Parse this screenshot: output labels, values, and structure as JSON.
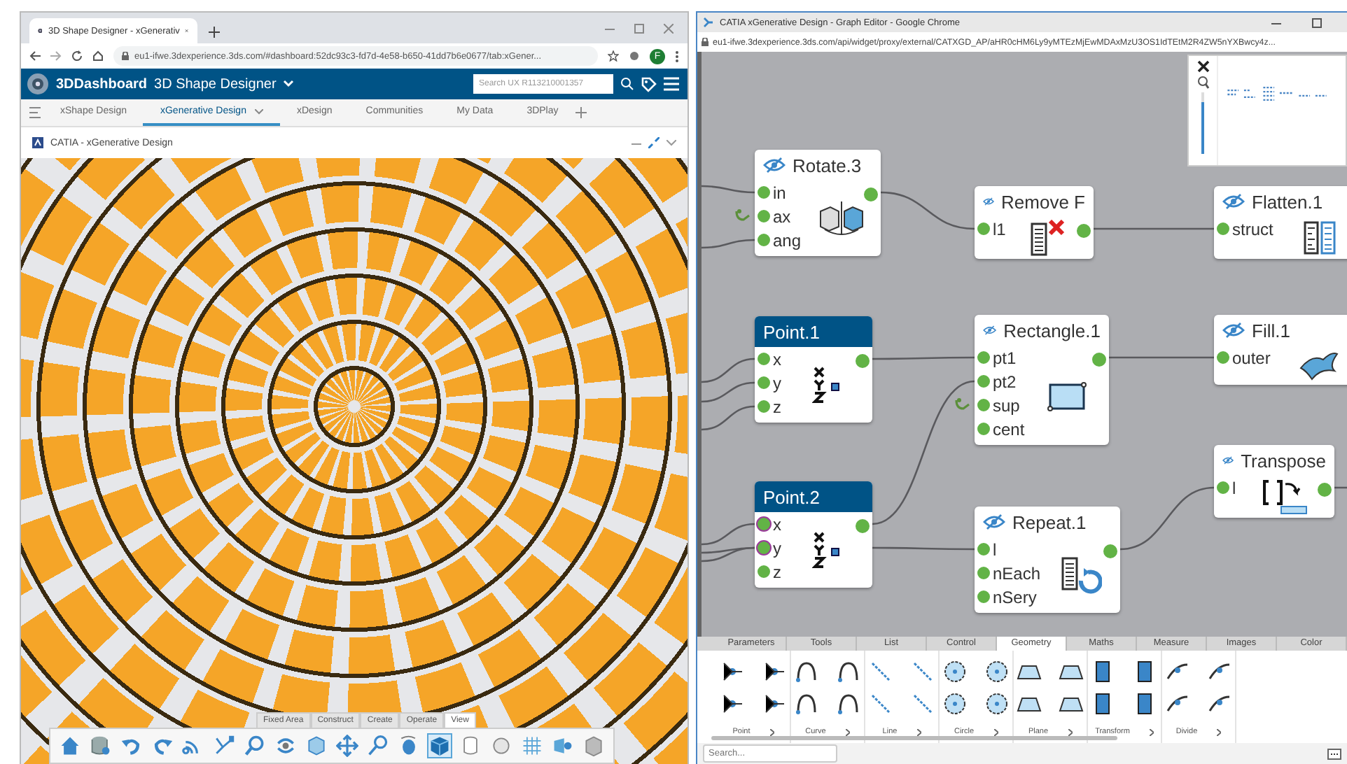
{
  "left_window": {
    "tab_title": "3D Shape Designer - xGenerativ",
    "url": "eu1-ifwe.3dexperience.3ds.com/#dashboard:52dc93c3-fd7d-4e58-b650-41dd7b6e0677/tab:xGener...",
    "avatar": "F",
    "app_bar": {
      "brand": "3DDashboard",
      "title": "3D Shape Designer",
      "search": {
        "placeholder": "Search UX R113210001357"
      }
    },
    "tabs": [
      {
        "label": "xShape Design",
        "selected": false
      },
      {
        "label": "xGenerative Design",
        "selected": true
      },
      {
        "label": "xDesign",
        "selected": false
      },
      {
        "label": "Communities",
        "selected": false
      },
      {
        "label": "My Data",
        "selected": false
      },
      {
        "label": "3DPlay",
        "selected": false
      }
    ],
    "widget": {
      "title": "CATIA - xGenerative Design"
    },
    "action_bar": {
      "tabs": [
        {
          "label": "Fixed Area",
          "selected": false
        },
        {
          "label": "Construct",
          "selected": false
        },
        {
          "label": "Create",
          "selected": false
        },
        {
          "label": "Operate",
          "selected": false
        },
        {
          "label": "View",
          "selected": true
        }
      ]
    }
  },
  "right_window": {
    "title": "CATIA xGenerative Design - Graph Editor - Google Chrome",
    "url": "eu1-ifwe.3dexperience.3ds.com/api/widget/proxy/external/CATXGD_AP/aHR0cHM6Ly9yMTEzMjEwMDAxMzU3OS1IdTEtM2R4ZW5nYXBwcy4z...",
    "zoom_slider": {
      "level": 0.85
    },
    "nodes": [
      {
        "title": "Rotate.3",
        "kind": "rotate",
        "selected": false,
        "visibility_off": true,
        "inputs": [
          {
            "label": "in",
            "kind": "data",
            "highlighted": false
          },
          {
            "label": "ax",
            "kind": "parameter",
            "highlighted": false
          },
          {
            "label": "ang",
            "kind": "data",
            "highlighted": false
          }
        ]
      },
      {
        "title": "Remove F",
        "kind": "remove",
        "selected": false,
        "visibility_off": true,
        "inputs": [
          {
            "label": "l1",
            "kind": "data",
            "highlighted": false
          }
        ]
      },
      {
        "title": "Flatten.1",
        "kind": "flatten",
        "selected": false,
        "visibility_off": true,
        "inputs": [
          {
            "label": "struct",
            "kind": "data",
            "highlighted": false
          }
        ]
      },
      {
        "title": "Point.1",
        "kind": "point",
        "selected": true,
        "visibility_off": false,
        "inputs": [
          {
            "label": "x",
            "kind": "data",
            "highlighted": false
          },
          {
            "label": "y",
            "kind": "data",
            "highlighted": false
          },
          {
            "label": "z",
            "kind": "data",
            "highlighted": false
          }
        ]
      },
      {
        "title": "Rectangle.1",
        "kind": "rectangle",
        "selected": false,
        "visibility_off": true,
        "inputs": [
          {
            "label": "pt1",
            "kind": "data",
            "highlighted": false
          },
          {
            "label": "pt2",
            "kind": "data",
            "highlighted": false
          },
          {
            "label": "sup",
            "kind": "parameter",
            "highlighted": false
          },
          {
            "label": "cent",
            "kind": "data",
            "highlighted": false
          }
        ]
      },
      {
        "title": "Fill.1",
        "kind": "fill",
        "selected": false,
        "visibility_off": true,
        "inputs": [
          {
            "label": "outer",
            "kind": "data",
            "highlighted": false
          }
        ]
      },
      {
        "title": "Transpose",
        "kind": "transpose",
        "selected": false,
        "visibility_off": true,
        "inputs": [
          {
            "label": "l",
            "kind": "data",
            "highlighted": false
          }
        ]
      },
      {
        "title": "Point.2",
        "kind": "point",
        "selected": true,
        "visibility_off": false,
        "inputs": [
          {
            "label": "x",
            "kind": "data",
            "highlighted": true
          },
          {
            "label": "y",
            "kind": "data",
            "highlighted": true
          },
          {
            "label": "z",
            "kind": "data",
            "highlighted": false
          }
        ]
      },
      {
        "title": "Repeat.1",
        "kind": "repeat",
        "selected": false,
        "visibility_off": true,
        "inputs": [
          {
            "label": "l",
            "kind": "data",
            "highlighted": false
          },
          {
            "label": "nEach",
            "kind": "data",
            "highlighted": false
          },
          {
            "label": "nSery",
            "kind": "data",
            "highlighted": false
          }
        ]
      }
    ],
    "palette": {
      "tabs": [
        {
          "label": "Parameters",
          "selected": false
        },
        {
          "label": "Tools",
          "selected": false
        },
        {
          "label": "List",
          "selected": false
        },
        {
          "label": "Control",
          "selected": false
        },
        {
          "label": "Geometry",
          "selected": true
        },
        {
          "label": "Maths",
          "selected": false
        },
        {
          "label": "Measure",
          "selected": false
        },
        {
          "label": "Images",
          "selected": false
        },
        {
          "label": "Color",
          "selected": false
        }
      ],
      "groups": [
        {
          "label": "Point"
        },
        {
          "label": "Curve"
        },
        {
          "label": "Line"
        },
        {
          "label": "Circle"
        },
        {
          "label": "Plane"
        },
        {
          "label": "Transform"
        },
        {
          "label": "Divide"
        }
      ]
    },
    "search": {
      "placeholder": "Search..."
    }
  }
}
